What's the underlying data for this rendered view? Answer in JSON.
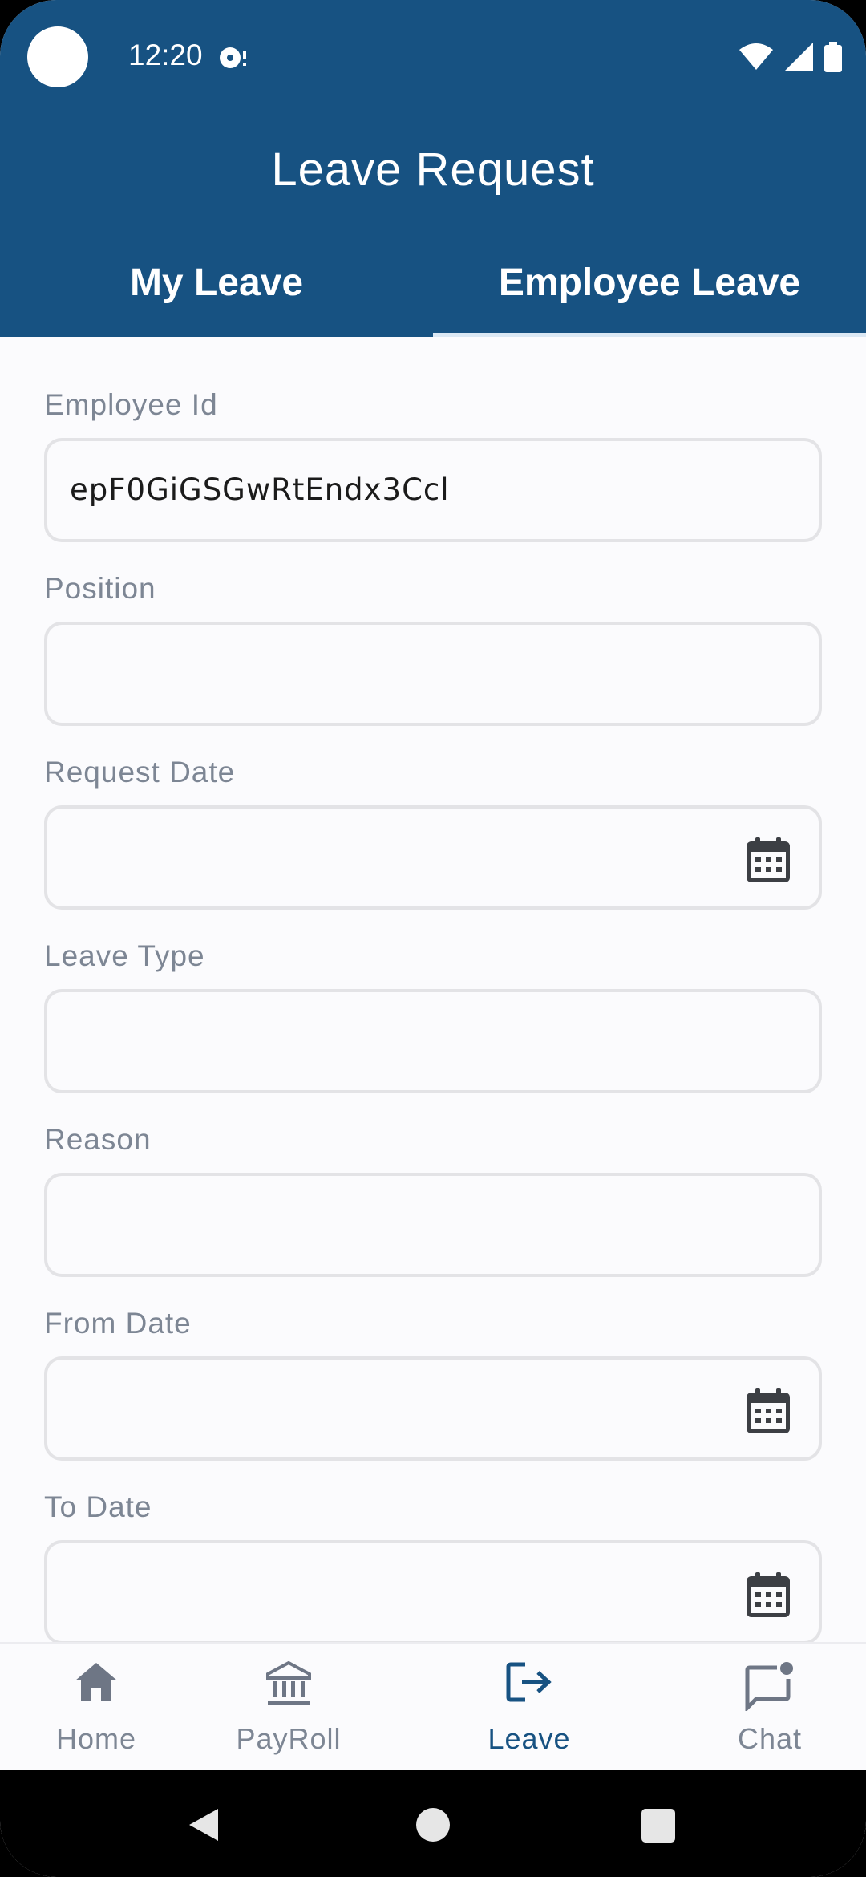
{
  "status_bar": {
    "time": "12:20"
  },
  "app": {
    "title": "Leave Request"
  },
  "tabs": [
    {
      "label": "My Leave",
      "selected": false
    },
    {
      "label": "Employee Leave",
      "selected": true
    }
  ],
  "form": {
    "fields": [
      {
        "label": "Employee Id",
        "value": "epF0GiGSGwRtEndx3Ccl",
        "icon": null
      },
      {
        "label": "Position",
        "value": "",
        "icon": null
      },
      {
        "label": "Request Date",
        "value": "",
        "icon": "calendar-icon"
      },
      {
        "label": "Leave Type",
        "value": "",
        "icon": null
      },
      {
        "label": "Reason",
        "value": "",
        "icon": null
      },
      {
        "label": "From Date",
        "value": "",
        "icon": "calendar-icon"
      },
      {
        "label": "To Date",
        "value": "",
        "icon": "calendar-icon"
      }
    ]
  },
  "bottom_nav": {
    "items": [
      {
        "label": "Home",
        "icon": "home-icon",
        "active": false
      },
      {
        "label": "PayRoll",
        "icon": "bank-icon",
        "active": false
      },
      {
        "label": "Leave",
        "icon": "logout-icon",
        "active": true
      },
      {
        "label": "Chat",
        "icon": "chat-icon",
        "active": false
      }
    ]
  },
  "colors": {
    "primary": "#175282",
    "background": "#fbfbfd",
    "label": "#7d8694",
    "border": "#e3e3e6"
  }
}
